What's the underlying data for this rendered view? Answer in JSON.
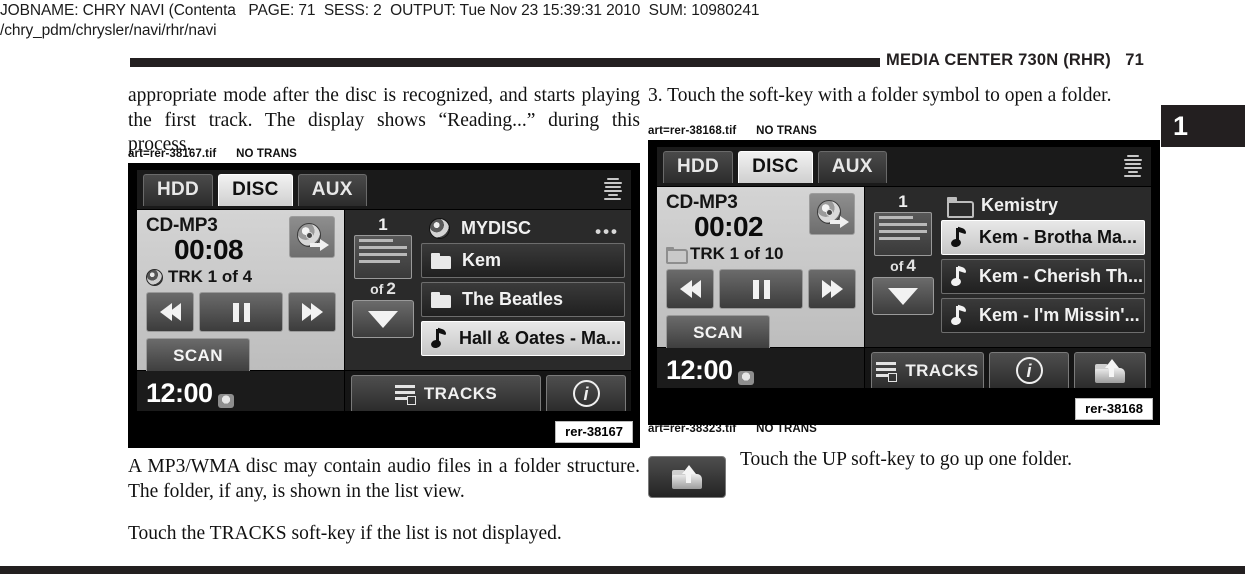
{
  "print_header": {
    "line1": "JOBNAME: CHRY NAVI (Contenta   PAGE: 71  SESS: 2  OUTPUT: Tue Nov 23 15:39:31 2010  SUM: 10980241",
    "line2": "/chry_pdm/chrysler/navi/rhr/navi"
  },
  "running_head": {
    "title": "MEDIA CENTER 730N (RHR)   71"
  },
  "chapter_tab": {
    "number": "1"
  },
  "body": {
    "left_top_paragraph": "appropriate mode after the disc is recognized, and starts playing the first track. The display shows “Reading...” during this process.",
    "right_top_paragraph": "3. Touch the soft-key with a folder symbol to open a folder.",
    "left_lower_paragraph_1": "A MP3/WMA disc may contain audio files in a folder structure. The folder, if any, is shown in the list view.",
    "left_lower_paragraph_2": "Touch the TRACKS soft-key if the list is not displayed.",
    "up_key_caption": "Touch the UP soft-key to go up one folder."
  },
  "art_labels": {
    "fig1": "art=rer-38167.tif      NO TRANS",
    "fig2": "art=rer-38168.tif      NO TRANS",
    "fig3": "art=rer-38323.tif      NO TRANS"
  },
  "figures": {
    "left": {
      "caption": "rer-38167",
      "tabs": [
        {
          "label": "HDD",
          "active": false
        },
        {
          "label": "DISC",
          "active": true
        },
        {
          "label": "AUX",
          "active": false
        }
      ],
      "media_type": "CD-MP3",
      "elapsed": "00:08",
      "track_line": "TRK 1 of 4",
      "track_icon": "cd-icon",
      "scan_label": "SCAN",
      "page_current": "1",
      "page_of_label": "of",
      "page_total": "2",
      "list_title": "MYDISC",
      "list_title_icon": "cd-icon",
      "list_overflow": "•••",
      "rows": [
        {
          "label": "Kem",
          "icon": "folder-icon",
          "selected": false
        },
        {
          "label": "The Beatles",
          "icon": "folder-icon",
          "selected": false
        },
        {
          "label": "Hall & Oates - Ma...",
          "icon": "music-note-icon",
          "selected": true
        }
      ],
      "clock": "12:00",
      "tracks_label": "TRACKS",
      "info_label": "i",
      "has_up_key": false
    },
    "right": {
      "caption": "rer-38168",
      "tabs": [
        {
          "label": "HDD",
          "active": false
        },
        {
          "label": "DISC",
          "active": true
        },
        {
          "label": "AUX",
          "active": false
        }
      ],
      "media_type": "CD-MP3",
      "elapsed": "00:02",
      "track_line": "TRK 1 of 10",
      "track_icon": "folder-icon",
      "scan_label": "SCAN",
      "page_current": "1",
      "page_of_label": "of",
      "page_total": "4",
      "list_title": "Kemistry",
      "list_title_icon": "folder-icon",
      "list_overflow": "",
      "rows": [
        {
          "label": "Kem - Brotha Ma...",
          "icon": "music-note-icon",
          "selected": true
        },
        {
          "label": "Kem - Cherish Th...",
          "icon": "music-note-icon",
          "selected": false
        },
        {
          "label": "Kem - I'm Missin'...",
          "icon": "music-note-icon",
          "selected": false
        }
      ],
      "clock": "12:00",
      "tracks_label": "TRACKS",
      "info_label": "i",
      "has_up_key": true
    }
  },
  "colors": {
    "rule": "#231f20",
    "screen_bg": "#1e1e1e",
    "panel_light": "#c9c9c9",
    "selected_row": "#e0e0e0"
  }
}
